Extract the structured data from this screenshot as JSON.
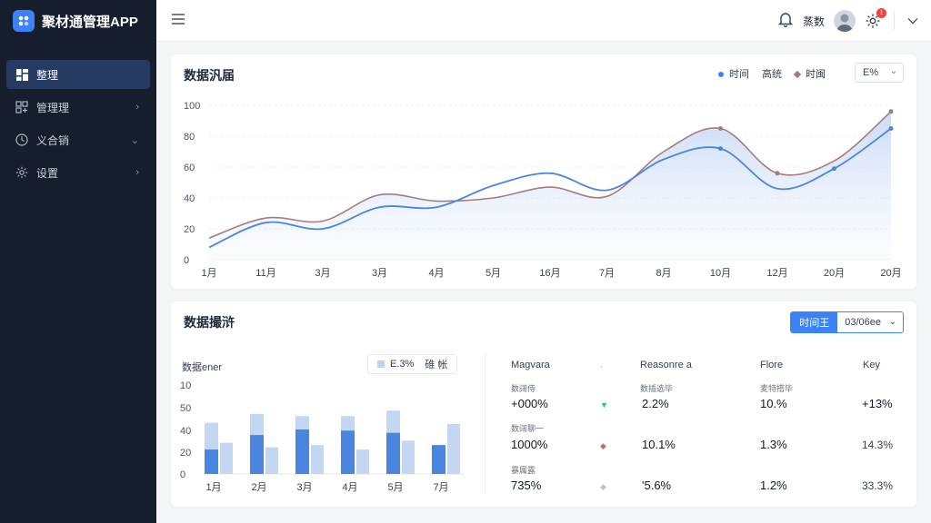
{
  "app": {
    "title": "聚材通管理APP"
  },
  "sidebar": {
    "items": [
      {
        "label": "整理",
        "icon": "dashboard-icon",
        "active": true
      },
      {
        "label": "管理理",
        "icon": "settings-sliders-icon",
        "chevron": "right"
      },
      {
        "label": "义合销",
        "icon": "clock-icon",
        "chevron": "down"
      },
      {
        "label": "设置",
        "icon": "gear-icon",
        "chevron": "right"
      }
    ]
  },
  "header": {
    "user_name": "蒸数",
    "notification_count": "1"
  },
  "overview": {
    "title": "数据汎届",
    "legend": [
      {
        "label": "时间",
        "color": "#3b82f6"
      },
      {
        "label": "高统",
        "color": null
      },
      {
        "label": "时闽",
        "color": "#a67878"
      }
    ],
    "select_value": "E%"
  },
  "chart_data": [
    {
      "type": "line",
      "categories": [
        "1月",
        "11月",
        "3月",
        "3月",
        "4月",
        "5月",
        "16月",
        "7月",
        "8月",
        "10月",
        "12月",
        "20月",
        "20月"
      ],
      "series": [
        {
          "color": "#4a86e0",
          "values": [
            8,
            24,
            20,
            34,
            34,
            48,
            56,
            45,
            65,
            72,
            46,
            59,
            85
          ]
        },
        {
          "color": "#a77b7b",
          "values": [
            14,
            27,
            25,
            42,
            38,
            40,
            47,
            41,
            70,
            85,
            56,
            64,
            96
          ]
        }
      ],
      "ylim": [
        0,
        100
      ],
      "yticks": [
        0,
        20,
        40,
        60,
        80,
        100
      ],
      "grid": true
    },
    {
      "type": "bar",
      "categories": [
        "1月",
        "2月",
        "3月",
        "4月",
        "5月",
        "7月"
      ],
      "series": [
        {
          "color": "#4a86e0",
          "values": [
            22,
            35,
            40,
            39,
            37,
            26
          ]
        },
        {
          "color": "#c3d6f2",
          "values": [
            46,
            54,
            52,
            52,
            57,
            0
          ]
        },
        {
          "color": "#c3d6f2",
          "values": [
            28,
            24,
            26,
            22,
            30,
            45
          ]
        }
      ],
      "ylim": [
        0,
        80
      ],
      "ytick_labels": [
        "0",
        "20",
        "40",
        "50",
        "10"
      ]
    }
  ],
  "analysis": {
    "title": "数据撮浒",
    "btn_primary": "时间王",
    "btn_secondary": "03/06ee",
    "sub_title": "数据ener",
    "mini_legend": {
      "value": "E.3%",
      "label": "碓 帐"
    },
    "columns": [
      "Magvara",
      "Reasonre a",
      "Flore",
      "Key"
    ],
    "rows": [
      {
        "label": "数阔侍",
        "value": "+000%",
        "trend_color": "#22c55e",
        "trend_glyph": "▼",
        "c2_label": "数插选毕",
        "c2_value": "2.2%",
        "c3_label": "麦特搭毕",
        "c3_value": "10.%",
        "c4_value": "+13%"
      },
      {
        "label": "数阔聊一",
        "value": "1000%",
        "trend_color": "#c2735b",
        "trend_glyph": "◆",
        "c2_value": "10.1%",
        "c3_value": "1.3%",
        "c4_value": "14.3%"
      },
      {
        "label": "暴属露",
        "value": "735%",
        "trend_color": "#c2c2c2",
        "trend_glyph": "◆",
        "c2_value": "'5.6%",
        "c3_value": "1.2%",
        "c4_value": "33.3%"
      }
    ]
  }
}
